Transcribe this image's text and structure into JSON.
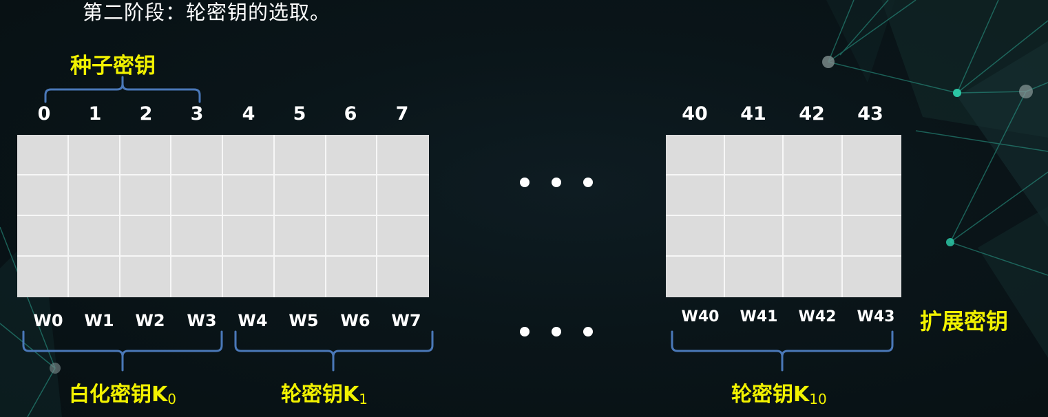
{
  "title": "第二阶段：轮密钥的选取。",
  "seed_key_label": "种子密钥",
  "expanded_key_label": "扩展密钥",
  "left_indices": [
    "0",
    "1",
    "2",
    "3",
    "4",
    "5",
    "6",
    "7"
  ],
  "right_indices": [
    "40",
    "41",
    "42",
    "43"
  ],
  "left_words": [
    "W0",
    "W1",
    "W2",
    "W3",
    "W4",
    "W5",
    "W6",
    "W7"
  ],
  "right_words": [
    "W40",
    "W41",
    "W42",
    "W43"
  ],
  "key_groups": [
    {
      "name": "白化密钥K",
      "sub": "0"
    },
    {
      "name": "轮密钥K",
      "sub": "1"
    },
    {
      "name": "轮密钥K",
      "sub": "10"
    }
  ],
  "colors": {
    "highlight": "#f2f200",
    "bracket": "#4a78b8",
    "cell": "#dcdcdc"
  }
}
